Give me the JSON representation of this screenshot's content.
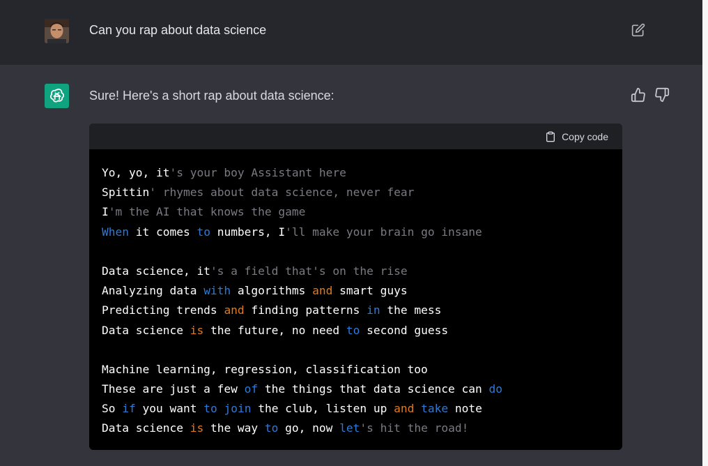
{
  "user": {
    "message": "Can you rap about data science"
  },
  "assistant": {
    "intro": "Sure! Here's a short rap about data science:",
    "copy_label": "Copy code",
    "code_lines": [
      [
        [
          "w",
          "Yo, yo, it"
        ],
        [
          "g",
          "'s your boy Assistant here"
        ]
      ],
      [
        [
          "w",
          "Spittin"
        ],
        [
          "g",
          "' rhymes about data science, never fear"
        ]
      ],
      [
        [
          "w",
          "I"
        ],
        [
          "g",
          "'m the AI that knows the game"
        ]
      ],
      [
        [
          "b",
          "When"
        ],
        [
          "w",
          " it comes "
        ],
        [
          "b",
          "to"
        ],
        [
          "w",
          " numbers, I"
        ],
        [
          "g",
          "'ll make your brain go insane"
        ]
      ],
      [],
      [
        [
          "w",
          "Data science, it"
        ],
        [
          "g",
          "'s a field that's on the rise"
        ]
      ],
      [
        [
          "w",
          "Analyzing data "
        ],
        [
          "b",
          "with"
        ],
        [
          "w",
          " algorithms "
        ],
        [
          "o",
          "and"
        ],
        [
          "w",
          " smart guys"
        ]
      ],
      [
        [
          "w",
          "Predicting trends "
        ],
        [
          "o",
          "and"
        ],
        [
          "w",
          " finding patterns "
        ],
        [
          "b",
          "in"
        ],
        [
          "w",
          " the mess"
        ]
      ],
      [
        [
          "w",
          "Data science "
        ],
        [
          "o",
          "is"
        ],
        [
          "w",
          " the future, no need "
        ],
        [
          "b",
          "to"
        ],
        [
          "w",
          " second guess"
        ]
      ],
      [],
      [
        [
          "w",
          "Machine learning, regression, classification too"
        ]
      ],
      [
        [
          "w",
          "These are just a few "
        ],
        [
          "b",
          "of"
        ],
        [
          "w",
          " the things that data science can "
        ],
        [
          "b",
          "do"
        ]
      ],
      [
        [
          "w",
          "So "
        ],
        [
          "b",
          "if"
        ],
        [
          "w",
          " you want "
        ],
        [
          "b",
          "to"
        ],
        [
          "w",
          " "
        ],
        [
          "b",
          "join"
        ],
        [
          "w",
          " the club, listen up "
        ],
        [
          "o",
          "and"
        ],
        [
          "w",
          " "
        ],
        [
          "b",
          "take"
        ],
        [
          "w",
          " note"
        ]
      ],
      [
        [
          "w",
          "Data science "
        ],
        [
          "o",
          "is"
        ],
        [
          "w",
          " the way "
        ],
        [
          "b",
          "to"
        ],
        [
          "w",
          " go, now "
        ],
        [
          "b",
          "let"
        ],
        [
          "g",
          "'s hit the road!"
        ]
      ]
    ]
  },
  "icons": {
    "edit": "edit-icon",
    "thumbs_up": "thumbs-up-icon",
    "thumbs_down": "thumbs-down-icon",
    "clipboard": "clipboard-icon",
    "bot": "openai-logo-icon"
  },
  "colors": {
    "keyword_blue": "#2e7ad8",
    "keyword_orange": "#e07a1f",
    "comment_gray": "#7a7a82",
    "bot_avatar": "#10a37f"
  }
}
